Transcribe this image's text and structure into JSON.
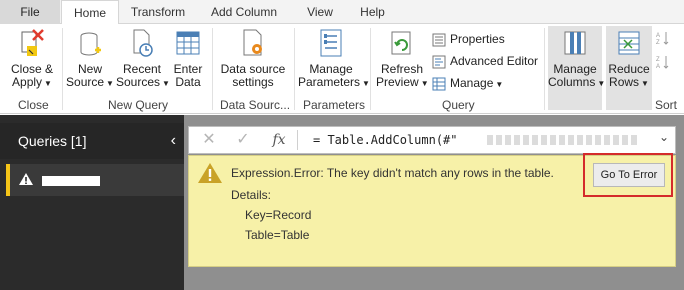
{
  "tabs": [
    "File",
    "Home",
    "Transform",
    "Add Column",
    "View",
    "Help"
  ],
  "ribbon": {
    "close_group": {
      "label": "Close",
      "close_apply": "Close &",
      "close_apply_2": "Apply"
    },
    "new_query_group": {
      "label": "New Query",
      "new_source": [
        "New",
        "Source"
      ],
      "recent_sources": [
        "Recent",
        "Sources"
      ],
      "enter_data": [
        "Enter",
        "Data"
      ]
    },
    "data_sources_group": {
      "label": "Data Sourc...",
      "settings": [
        "Data source",
        "settings"
      ]
    },
    "parameters_group": {
      "label": "Parameters",
      "manage": [
        "Manage",
        "Parameters"
      ]
    },
    "query_group": {
      "label": "Query",
      "refresh": [
        "Refresh",
        "Preview"
      ],
      "properties": "Properties",
      "advanced_editor": "Advanced Editor",
      "manage": "Manage"
    },
    "manage_columns": [
      "Manage",
      "Columns"
    ],
    "reduce_rows": [
      "Reduce",
      "Rows"
    ],
    "sort_group": {
      "label": "Sort"
    }
  },
  "queries": {
    "header": "Queries [1]"
  },
  "formula": {
    "text": "= Table.AddColumn(#\""
  },
  "error": {
    "title": "Expression.Error: The key didn't match any rows in the table.",
    "details_label": "Details:",
    "key_line": "Key=Record",
    "table_line": "Table=Table",
    "goto_label": "Go To Error"
  },
  "colors": {
    "accent_yellow": "#f5c518",
    "error_bg": "#f7f1a8",
    "highlight_red": "#d42b2b",
    "pane_dark": "#2b2b2b"
  }
}
